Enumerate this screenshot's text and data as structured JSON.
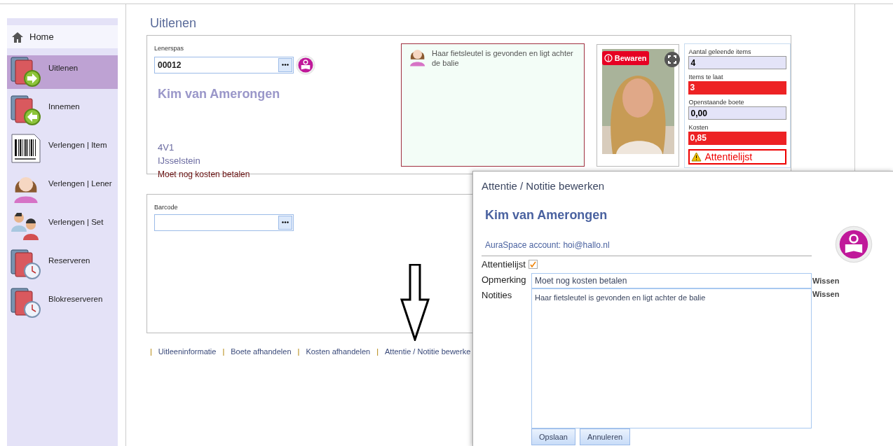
{
  "sidebar": {
    "home": "Home",
    "items": [
      {
        "label": "Uitlenen",
        "kind": "books-out",
        "selected": true
      },
      {
        "label": "Innemen",
        "kind": "books-in",
        "selected": false
      },
      {
        "label": "Verlengen | Item",
        "kind": "barcode",
        "selected": false
      },
      {
        "label": "Verlengen | Lener",
        "kind": "woman",
        "selected": false
      },
      {
        "label": "Verlengen | Set",
        "kind": "people",
        "selected": false
      },
      {
        "label": "Reserveren",
        "kind": "books-clock",
        "selected": false
      },
      {
        "label": "Blokreserveren",
        "kind": "books-clock",
        "selected": false
      }
    ]
  },
  "page_title": "Uitlenen",
  "lener": {
    "label": "Lenerspas",
    "value": "00012",
    "name": "Kim van Amerongen",
    "group": "4V1",
    "city": "IJsselstein",
    "remark": "Moet nog kosten betalen"
  },
  "note": "Haar fietsleutel is gevonden en ligt achter de balie",
  "photo": {
    "kind": "picture",
    "pin_label": "Bewaren"
  },
  "stats": [
    {
      "label": "Aantal geleende items",
      "value": "4",
      "alert": false
    },
    {
      "label": "Items te laat",
      "value": "3",
      "alert": true
    },
    {
      "label": "Openstaande boete",
      "value": "0,00",
      "alert": false
    },
    {
      "label": "Kosten",
      "value": "0,85",
      "alert": true
    }
  ],
  "attention_badge": "Attentielijst",
  "barcode": {
    "label": "Barcode"
  },
  "links": [
    {
      "separator": "|",
      "label": "Uitleeninformatie"
    },
    {
      "separator": "|",
      "label": "Boete afhandelen"
    },
    {
      "separator": "|",
      "label": "Kosten afhandelen"
    },
    {
      "separator": "|",
      "label": "Attentie / Notitie bewerke"
    }
  ],
  "dialog": {
    "title": "Attentie / Notitie bewerken",
    "name": "Kim van Amerongen",
    "account": "AuraSpace account: hoi@hallo.nl",
    "attention": {
      "label": "Attentielijst",
      "checked": true
    },
    "remark": {
      "label": "Opmerking",
      "value": "Moet nog kosten betalen",
      "clear": "Wissen"
    },
    "notes": {
      "label": "Notities",
      "value": "Haar fietsleutel is gevonden en ligt achter de balie",
      "clear": "Wissen"
    },
    "buttons": [
      "Opslaan",
      "Annuleren"
    ]
  }
}
